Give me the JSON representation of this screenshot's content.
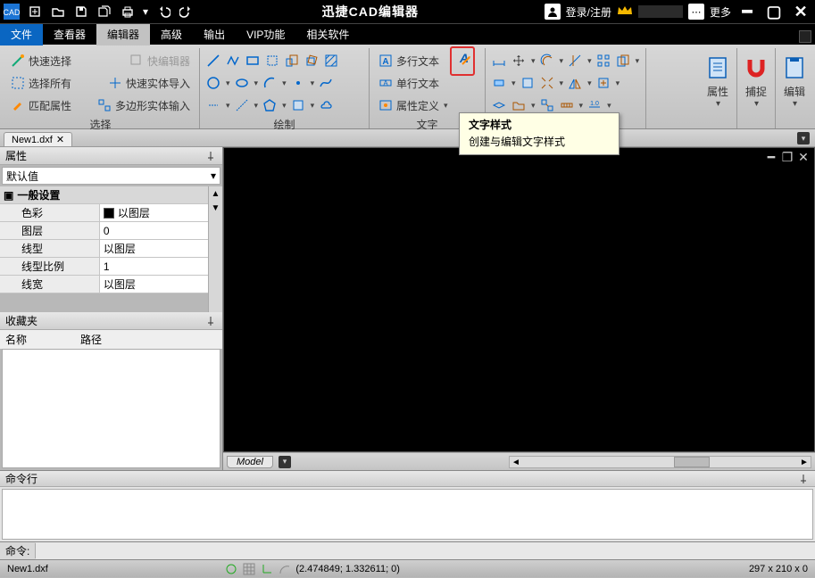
{
  "app": {
    "title": "迅捷CAD编辑器",
    "login": "登录/注册",
    "more": "更多"
  },
  "menus": {
    "file": "文件",
    "viewer": "查看器",
    "editor": "编辑器",
    "advanced": "高级",
    "output": "输出",
    "vip": "VIP功能",
    "related": "相关软件"
  },
  "ribbon": {
    "sel": {
      "quick_select": "快速选择",
      "select_all": "选择所有",
      "match_props": "匹配属性",
      "quick_editor": "快编辑器",
      "entity_import": "快速实体导入",
      "poly_entity_input": "多边形实体输入",
      "group": "选择"
    },
    "draw": {
      "group": "绘制"
    },
    "text": {
      "mtext": "多行文本",
      "stext": "单行文本",
      "attrdef": "属性定义",
      "group": "文字"
    },
    "big": {
      "props": "属性",
      "snap": "捕捉",
      "edit": "编辑"
    }
  },
  "tooltip": {
    "title": "文字样式",
    "desc": "创建与编辑文字样式"
  },
  "doc": {
    "tab": "New1.dxf"
  },
  "props": {
    "title": "属性",
    "default": "默认值",
    "section": "一般设置",
    "rows": [
      {
        "k": "色彩",
        "v": "以图层",
        "swatch": true
      },
      {
        "k": "图层",
        "v": "0"
      },
      {
        "k": "线型",
        "v": "以图层"
      },
      {
        "k": "线型比例",
        "v": "1"
      },
      {
        "k": "线宽",
        "v": "以图层"
      }
    ]
  },
  "fav": {
    "title": "收藏夹",
    "col_name": "名称",
    "col_path": "路径"
  },
  "model": {
    "tab": "Model"
  },
  "cmd": {
    "title": "命令行",
    "prompt": "命令:"
  },
  "status": {
    "file": "New1.dxf",
    "coords": "(2.474849; 1.332611; 0)",
    "paper": "297 x 210 x 0"
  }
}
